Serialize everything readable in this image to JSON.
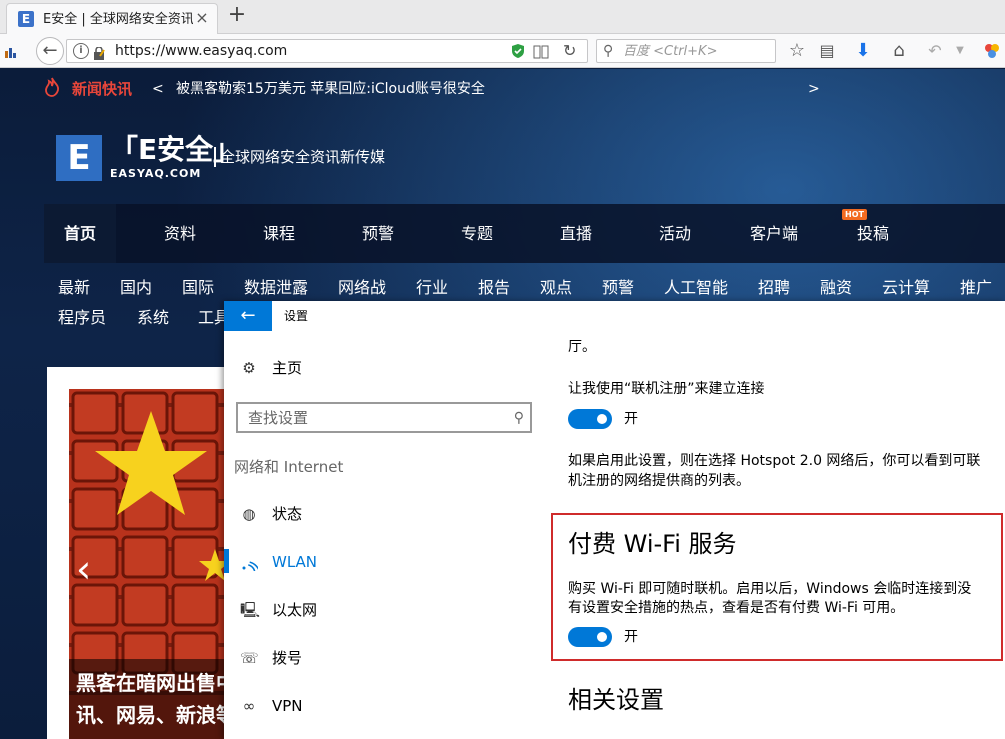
{
  "browser": {
    "tab_title": "E安全 | 全球网络安全资讯...",
    "tab_favicon": "E",
    "tab_close": "×",
    "new_tab": "+",
    "url": "https://www.easyaq.com",
    "search_placeholder": "百度 <Ctrl+K>"
  },
  "site": {
    "ticker_label": "新闻快讯",
    "ticker_prev": "<",
    "ticker_text": "被黑客勒索15万美元 苹果回应:iCloud账号很安全",
    "ticker_next": ">",
    "logo_letter": "E",
    "logo_name": "「E安全」",
    "logo_domain": "EASYAQ.COM",
    "slogan": "全球网络安全资讯新传媒",
    "main_nav": [
      "首页",
      "资料",
      "课程",
      "预警",
      "专题",
      "直播",
      "活动",
      "客户端",
      "投稿"
    ],
    "hot_badge": "HOT",
    "sub_nav_row1": [
      "最新",
      "国内",
      "国际",
      "数据泄露",
      "网络战",
      "行业",
      "报告",
      "观点",
      "预警",
      "人工智能",
      "招聘",
      "融资",
      "云计算",
      "推广"
    ],
    "sub_nav_row2": [
      "程序员",
      "系统",
      "工具"
    ],
    "slide_prev": "‹",
    "article_title_line1": "黑客在暗网出售中",
    "article_title_line2": "讯、网易、新浪等"
  },
  "settings": {
    "back": "←",
    "title": "设置",
    "home": "主页",
    "search_placeholder": "查找设置",
    "category": "网络和 Internet",
    "nav": [
      {
        "label": "状态",
        "icon": "globe-icon"
      },
      {
        "label": "WLAN",
        "icon": "wifi-icon"
      },
      {
        "label": "以太网",
        "icon": "ethernet-icon"
      },
      {
        "label": "拨号",
        "icon": "dialup-icon"
      },
      {
        "label": "VPN",
        "icon": "vpn-icon"
      }
    ],
    "content": {
      "partial_top": "厅。",
      "hotspot_label": "让我使用“联机注册”来建立连接",
      "hotspot_toggle": "开",
      "hotspot_desc_1": "如果启用此设置，则在选择 Hotspot 2.0 网络后，你可以看到可联",
      "hotspot_desc_2": "机注册的网络提供商的列表。",
      "paid_heading": "付费 Wi-Fi 服务",
      "paid_desc_1": "购买 Wi-Fi 即可随时联机。启用以后，Windows 会临时连接到没",
      "paid_desc_2": "有设置安全措施的热点，查看是否有付费 Wi-Fi 可用。",
      "paid_toggle": "开",
      "related_heading": "相关设置"
    },
    "accent_color": "#0078d7",
    "highlight_color": "#cf2b2b"
  }
}
